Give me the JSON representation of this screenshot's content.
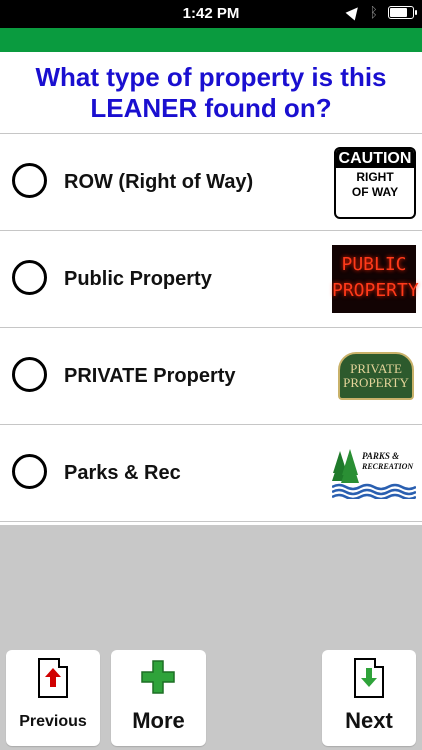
{
  "status_bar": {
    "time": "1:42 PM",
    "battery_level": 0.9
  },
  "question": {
    "text": "What type of property is this LEANER found on?",
    "color": "#1a0fd0"
  },
  "header_bar_color": "#0a9b3f",
  "options": [
    {
      "label": "ROW (Right of Way)",
      "thumb": {
        "caption": "CAUTION",
        "text": "RIGHT OF WAY"
      }
    },
    {
      "label": "Public Property",
      "thumb": {
        "line1": "PUBLIC",
        "line2": "PROPERTY"
      }
    },
    {
      "label": "PRIVATE Property",
      "thumb": {
        "line1": "PRIVATE",
        "line2": "PROPERTY"
      }
    },
    {
      "label": "Parks & Rec",
      "thumb": {
        "line1": "PARKS &",
        "line2": "RECREATION"
      }
    }
  ],
  "buttons": {
    "previous": "Previous",
    "more": "More",
    "next": "Next"
  }
}
